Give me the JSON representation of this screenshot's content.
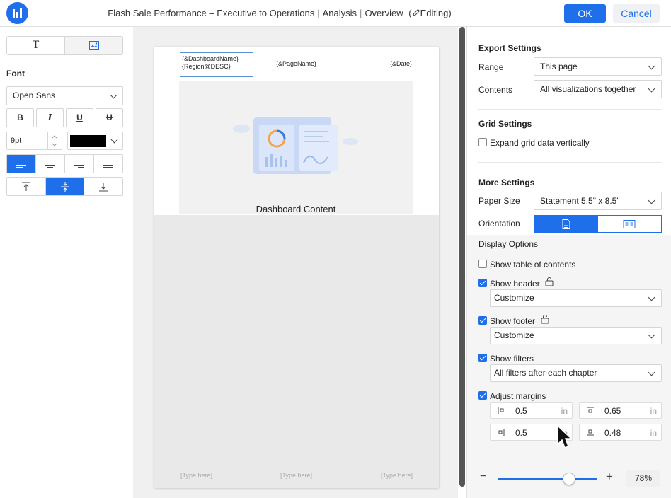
{
  "app": {
    "title_main": "Flash Sale Performance – Executive to Operations",
    "crumb_analysis": "Analysis",
    "crumb_overview": "Overview",
    "editing_label": "Editing",
    "ok_label": "OK",
    "cancel_label": "Cancel"
  },
  "left": {
    "text_tab_glyph": "T",
    "font_label": "Font",
    "font_family": "Open Sans",
    "bold": "B",
    "italic": "I",
    "underline": "U",
    "strikethrough": "U",
    "font_size": "9pt",
    "font_color": "#000000"
  },
  "canvas": {
    "header_name": "{&DashboardName} - {Region@DESC}",
    "header_page": "{&PageName}",
    "header_date": "{&Date}",
    "dashboard_caption": "Dashboard Content",
    "footer_left": "[Type here]",
    "footer_center": "[Type here]",
    "footer_right": "[Type here]"
  },
  "export": {
    "title": "Export Settings",
    "range_label": "Range",
    "range_value": "This page",
    "contents_label": "Contents",
    "contents_value": "All visualizations together"
  },
  "grid": {
    "title": "Grid Settings",
    "expand_label": "Expand grid data vertically",
    "expand_checked": false
  },
  "more": {
    "title": "More Settings",
    "paper_label": "Paper Size",
    "paper_value": "Statement 5.5\" x 8.5\"",
    "orientation_label": "Orientation",
    "orientation_selected": "portrait"
  },
  "display": {
    "title": "Display Options",
    "toc_label": "Show table of contents",
    "toc_checked": false,
    "header_label": "Show header",
    "header_checked": true,
    "header_select": "Customize",
    "footer_label": "Show footer",
    "footer_checked": true,
    "footer_select": "Customize",
    "filters_label": "Show filters",
    "filters_checked": true,
    "filters_select": "All filters after each chapter",
    "margins_label": "Adjust margins",
    "margins_checked": true,
    "margin_left": "0.5",
    "margin_top": "0.65",
    "margin_right": "0.5",
    "margin_bottom": "0.48",
    "unit": "in"
  },
  "zoom": {
    "minus": "−",
    "plus": "+",
    "value": "78%",
    "level": 0.78
  },
  "colors": {
    "accent": "#1f6feb"
  }
}
